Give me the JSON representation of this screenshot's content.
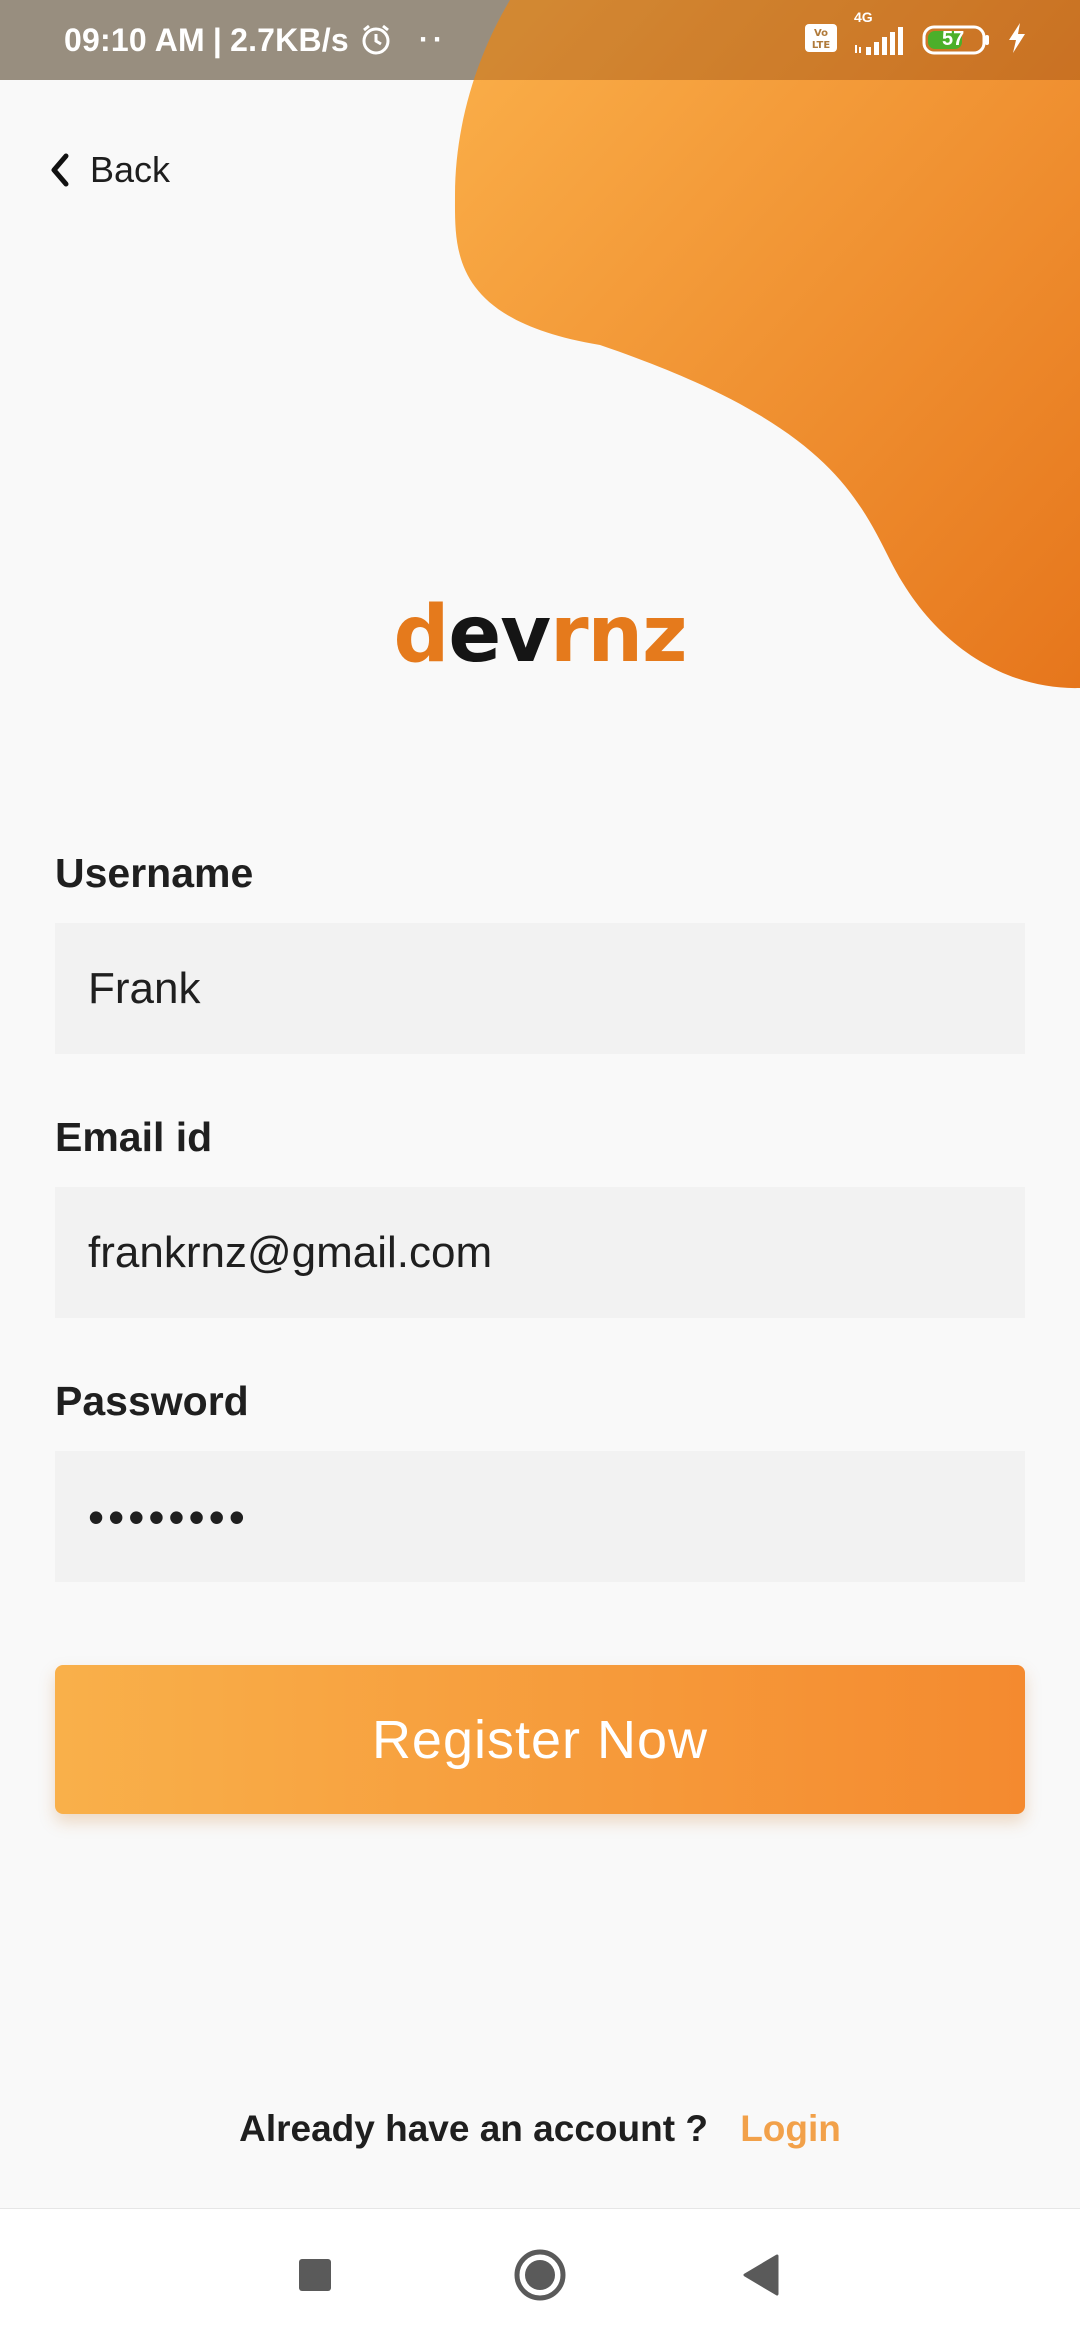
{
  "status_bar": {
    "time": "09:10 AM",
    "speed": "2.7KB/s",
    "more_dots": "··",
    "network": "4G",
    "battery_level": "57",
    "icons": [
      "alarm-icon",
      "volte-icon",
      "signal-icon",
      "battery-icon",
      "charging-icon"
    ]
  },
  "nav": {
    "back_label": "Back"
  },
  "brand": {
    "logo_parts": [
      "d",
      "ev",
      "rnz"
    ]
  },
  "form": {
    "username_label": "Username",
    "username_value": "Frank",
    "email_label": "Email id",
    "email_value": "frankrnz@gmail.com",
    "password_label": "Password",
    "password_value": "••••••••"
  },
  "actions": {
    "register_label": "Register Now"
  },
  "footer": {
    "prompt": "Already have an account ?",
    "login_label": "Login"
  },
  "system_nav": {
    "buttons": [
      "recents-icon",
      "home-icon",
      "back-triangle-icon"
    ]
  },
  "colors": {
    "accent_start": "#f9b04a",
    "accent_end": "#e8781e",
    "logo_orange": "#e57a1c",
    "login_link": "#f2a14a"
  }
}
